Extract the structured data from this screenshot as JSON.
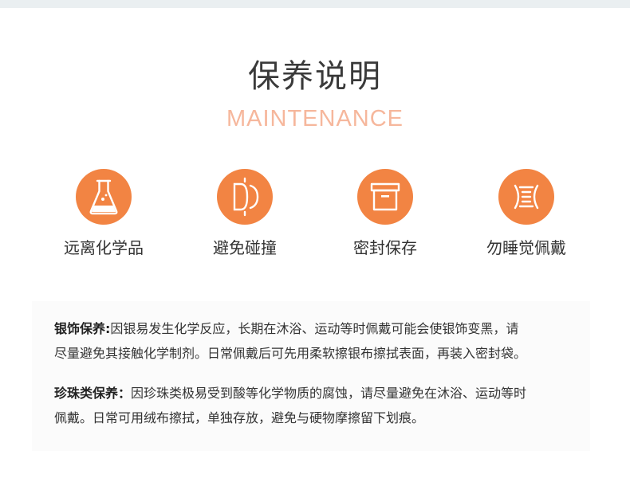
{
  "header": {
    "title": "保养说明",
    "subtitle": "MAINTENANCE"
  },
  "colors": {
    "accent": "#f28443",
    "subtitle": "#f6b79c",
    "topbar": "#eaeff1"
  },
  "features": [
    {
      "icon": "flask-icon",
      "label": "远离化学品"
    },
    {
      "icon": "collision-icon",
      "label": "避免碰撞"
    },
    {
      "icon": "box-icon",
      "label": "密封保存"
    },
    {
      "icon": "bracelet-icon",
      "label": "勿睡觉佩戴"
    }
  ],
  "care": {
    "silver": {
      "heading": "银饰保养",
      "sep": ":",
      "text_line1": "因银易发生化学反应，长期在沐浴、运动等时佩戴可能会使银饰变黑，请",
      "text_line2": "尽量避免其接触化学制剂。日常佩戴后可先用柔软擦银布擦拭表面，再装入密封袋。"
    },
    "pearl": {
      "heading": "珍珠类保养",
      "sep": "：",
      "text_line1": "因珍珠类极易受到酸等化学物质的腐蚀，请尽量避免在沐浴、运动等时",
      "text_line2": "佩戴。日常可用绒布擦拭，单独存放，避免与硬物摩擦留下划痕。"
    }
  }
}
